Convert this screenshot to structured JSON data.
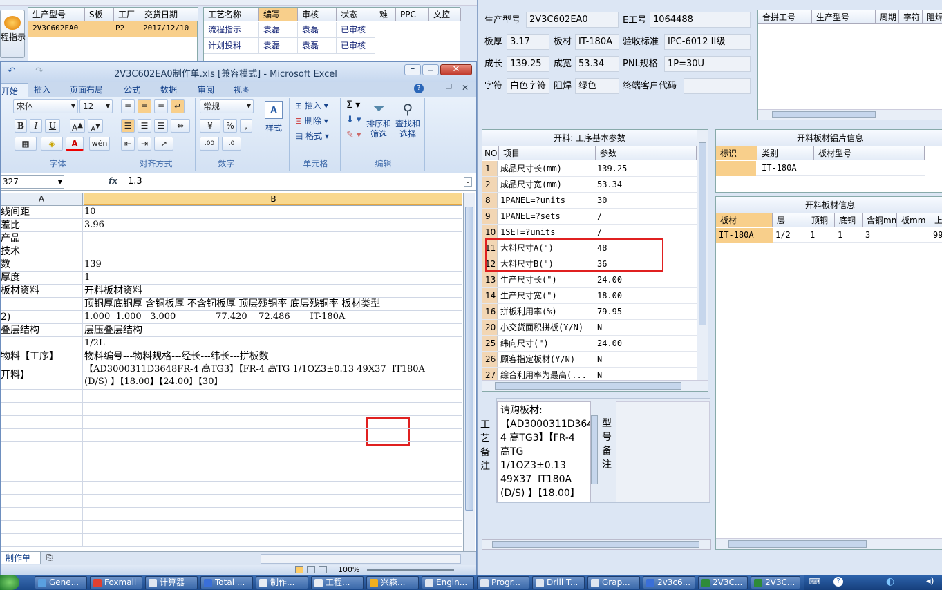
{
  "bg_app": {
    "left_button": "程指示",
    "grid1": {
      "headers": [
        "生产型号",
        "S板",
        "工厂",
        "交货日期"
      ],
      "row": [
        "2V3C602EA0",
        "",
        "P2",
        "2017/12/10"
      ]
    },
    "grid2": {
      "headers": [
        "工艺名称",
        "编写",
        "审核",
        "状态",
        "难",
        "PPC",
        "文控"
      ],
      "rows": [
        [
          "流程指示",
          "袁磊",
          "袁磊",
          "已审核"
        ],
        [
          "计划投料",
          "袁磊",
          "袁磊",
          "已审核"
        ]
      ]
    }
  },
  "excel": {
    "title": "2V3C602EA0制作单.xls  [兼容模式] - Microsoft Excel",
    "tabs": [
      "开始",
      "插入",
      "页面布局",
      "公式",
      "数据",
      "审阅",
      "视图"
    ],
    "font_name": "宋体",
    "font_size": "12",
    "number_format": "常规",
    "group_labels": [
      "字体",
      "对齐方式",
      "数字",
      "单元格",
      "编辑"
    ],
    "btn_style": "样式",
    "btn_insert": "插入",
    "btn_delete": "删除",
    "btn_format": "格式",
    "btn_sort": "排序和\n筛选",
    "btn_find": "查找和\n选择",
    "cell_ref": "327",
    "formula": "1.3",
    "col_a": "A",
    "col_b": "B",
    "rows": [
      {
        "a": "线间距",
        "b": "10"
      },
      {
        "a": "差比",
        "b": "3.96"
      },
      {
        "a": "产品",
        "b": ""
      },
      {
        "a": "技术",
        "b": ""
      },
      {
        "a": "数",
        "b": "139"
      },
      {
        "a": "厚度",
        "b": "1"
      },
      {
        "a": "板材资料",
        "b": "开料板材资料"
      },
      {
        "a": "",
        "b": "顶铜厚底铜厚 含铜板厚 不含铜板厚 顶层残铜率 底层残铜率 板材类型"
      },
      {
        "a": "2)",
        "b": "1.000  1.000   3.000              77.420    72.486       IT-180A"
      },
      {
        "a": "叠层结构",
        "b": "层压叠层结构"
      },
      {
        "a": "",
        "b": "1/2L"
      },
      {
        "a": "物料【工序】",
        "b": "物料编号---物料规格---经长---纬长---拼板数"
      },
      {
        "a": "开料】",
        "b": "【AD3000311D3648FR-4 高TG3】【FR-4 高TG 1/1OZ3±0.13 49X37  IT180A\n(D/S) 】【18.00】【24.00】【30】"
      }
    ],
    "sheet_tab": "制作单",
    "zoom": "100%"
  },
  "panel": {
    "model_label": "生产型号",
    "model": "2V3C602EA0",
    "e_label": "E工号",
    "e_no": "1064488",
    "thk_label": "板厚",
    "thk": "3.17",
    "mat_label": "板材",
    "mat": "IT-180A",
    "std_label": "验收标准",
    "std": "IPC-6012 II级",
    "len_label": "成长",
    "len": "139.25",
    "wid_label": "成宽",
    "wid": "53.34",
    "pnl_label": "PNL规格",
    "pnl": "1P=30U",
    "char_label": "字符",
    "char": "白色字符",
    "mask_label": "阻焊",
    "mask": "绿色",
    "cust_label": "终端客户代码",
    "cust": "",
    "merge_headers": [
      "合拼工号",
      "生产型号",
      "周期",
      "字符",
      "阻焊"
    ],
    "params_title": "开料: 工序基本参数",
    "params_headers": [
      "NO",
      "项目",
      "参数"
    ],
    "params": [
      {
        "no": "1",
        "name": "成品尺寸长(mm)",
        "val": "139.25"
      },
      {
        "no": "2",
        "name": "成品尺寸宽(mm)",
        "val": "53.34"
      },
      {
        "no": "8",
        "name": "1PANEL=?units",
        "val": "30"
      },
      {
        "no": "9",
        "name": "1PANEL=?sets",
        "val": "/"
      },
      {
        "no": "10",
        "name": "1SET=?units",
        "val": "/"
      },
      {
        "no": "11",
        "name": "大料尺寸A(\")",
        "val": "48"
      },
      {
        "no": "12",
        "name": "大料尺寸B(\")",
        "val": "36"
      },
      {
        "no": "13",
        "name": "生产尺寸长(\")",
        "val": "24.00"
      },
      {
        "no": "14",
        "name": "生产尺寸宽(\")",
        "val": "18.00"
      },
      {
        "no": "16",
        "name": "拼板利用率(%)",
        "val": "79.95"
      },
      {
        "no": "20",
        "name": "小交货面积拼板(Y/N)",
        "val": "N"
      },
      {
        "no": "25",
        "name": "纬向尺寸(\")",
        "val": "24.00"
      },
      {
        "no": "26",
        "name": "顾客指定板材(Y/N)",
        "val": "N"
      },
      {
        "no": "27",
        "name": "综合利用率为最高(...",
        "val": "N"
      }
    ],
    "memo_label": "工艺备注",
    "memo": "请购板材:\n【AD3000311D3648FR-4 高TG3】【FR-4 高TG\n1/1OZ3±0.13\n49X37  IT180A\n(D/S) 】【18.00】",
    "type_label": "型号备注",
    "chip_title": "开料板材铝片信息",
    "chip_headers": [
      "标识",
      "类别",
      "板材型号"
    ],
    "chip_row": [
      "",
      "IT-180A",
      ""
    ],
    "board_title": "开料板材信息",
    "board_headers": [
      "板材",
      "层",
      "顶铜",
      "底铜",
      "含铜mm",
      "板mm",
      "上"
    ],
    "board_row": [
      "IT-180A",
      "1/2",
      "1",
      "1",
      "3",
      "",
      "99"
    ]
  },
  "taskbar": [
    "Gene...",
    "Foxmail",
    "计算器",
    "Total ...",
    "制作...",
    "工程...",
    "兴森...",
    "Engin...",
    "Progr...",
    "Drill T...",
    "Grap...",
    "2v3c6...",
    "2V3C...",
    "2V3C..."
  ]
}
